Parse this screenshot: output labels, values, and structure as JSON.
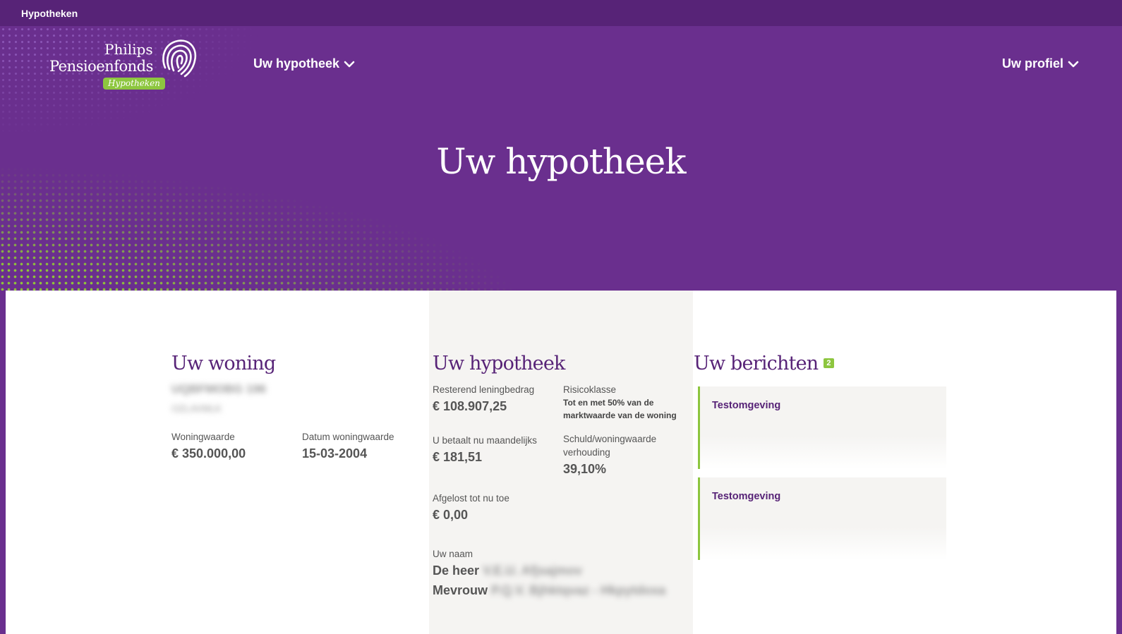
{
  "topbar": {
    "tab_label": "Hypotheken"
  },
  "logo": {
    "line1": "Philips",
    "line2": "Pensioenfonds",
    "badge": "Hypotheken"
  },
  "nav": {
    "hypotheek": "Uw hypotheek",
    "profiel": "Uw profiel"
  },
  "hero": {
    "title": "Uw hypotheek"
  },
  "woning": {
    "heading": "Uw woning",
    "address_line1": "UQBFMOBG 196",
    "address_line2": "OZLAVMLK",
    "woningwaarde_label": "Woningwaarde",
    "woningwaarde_value": "€ 350.000,00",
    "datum_label": "Datum woningwaarde",
    "datum_value": "15-03-2004"
  },
  "hypotheek": {
    "heading": "Uw hypotheek",
    "resterend_label": "Resterend leningbedrag",
    "resterend_value": "€ 108.907,25",
    "risico_label": "Risicoklasse",
    "risico_value_line1": "Tot en met 50% van de",
    "risico_value_line2": "marktwaarde van de woning",
    "maandelijks_label": "U betaalt nu maandelijks",
    "maandelijks_value": "€ 181,51",
    "schuld_label_line1": "Schuld/woningwaarde",
    "schuld_label_line2": "verhouding",
    "schuld_value": "39,10%",
    "afgelost_label": "Afgelost tot nu toe",
    "afgelost_value": "€ 0,00",
    "naam_label": "Uw naam",
    "naam1_prefix": "De heer",
    "naam1_blur": "V.E.U. Afjsajmov",
    "naam2_prefix": "Mevrouw",
    "naam2_blur": "P.Q.V. Bjhktqvaz - Hkpytdoxa"
  },
  "berichten": {
    "heading": "Uw berichten",
    "count": "2",
    "messages": [
      {
        "title": "Testomgeving"
      },
      {
        "title": "Testomgeving"
      }
    ]
  },
  "colors": {
    "purple": "#6a2f8e",
    "dark_purple": "#572377",
    "green": "#8dc63f",
    "panel": "#f5f4f2"
  },
  "icons": {
    "fingerprint": "fingerprint-logo-icon",
    "chevron": "chevron-down-icon"
  }
}
